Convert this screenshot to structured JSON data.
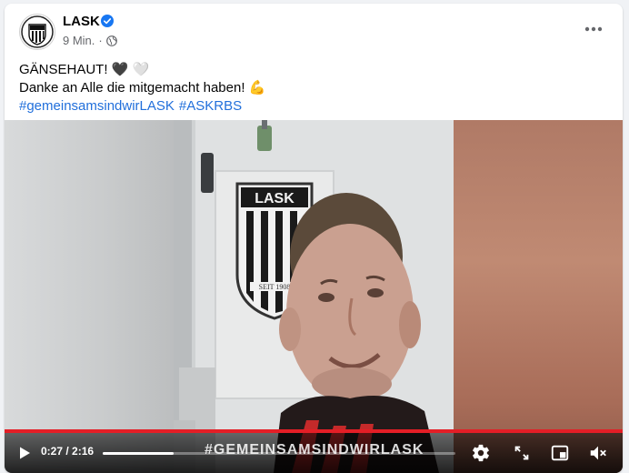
{
  "post": {
    "page_name": "LASK",
    "time": "9 Min.",
    "separator": "·",
    "line1": "GÄNSEHAUT! 🖤 🤍",
    "line2": "Danke an Alle die mitgemacht haben! 💪",
    "hashtags": [
      "#gemeinsamsindwirLASK",
      "#ASKRBS"
    ]
  },
  "video": {
    "current_time": "0:27",
    "duration": "2:16",
    "time_display": "0:27 / 2:16",
    "progress": 0.2,
    "caption": "#GEMEINSAMSINDWIRLASK",
    "logo_text": "LASK",
    "logo_sub": "SEIT 1908"
  },
  "icons": {
    "verified": "verified-badge-icon",
    "privacy": "globe-icon",
    "more": "more-options-icon",
    "play": "play-icon",
    "settings": "gear-icon",
    "fullscreen": "fullscreen-icon",
    "pip": "picture-in-picture-icon",
    "volume": "volume-muted-icon"
  },
  "colors": {
    "link": "#216fdb",
    "verified": "#1877f2",
    "progress_red": "#e41e26"
  }
}
